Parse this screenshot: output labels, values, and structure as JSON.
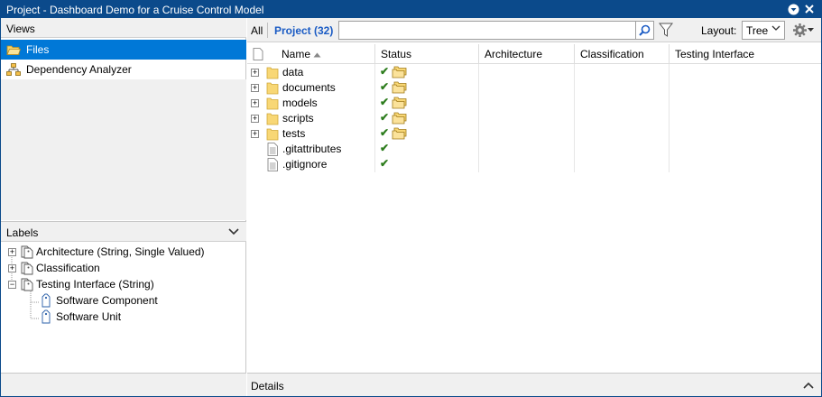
{
  "window": {
    "title": "Project - Dashboard Demo for a Cruise Control Model"
  },
  "views": {
    "header": "Views",
    "items": [
      {
        "label": "Files",
        "icon": "folder-open-icon",
        "selected": true
      },
      {
        "label": "Dependency Analyzer",
        "icon": "hierarchy-icon",
        "selected": false
      }
    ]
  },
  "labels": {
    "header": "Labels",
    "items": [
      {
        "label": "Architecture (String, Single Valued)"
      },
      {
        "label": "Classification"
      },
      {
        "label": "Testing Interface (String)"
      },
      {
        "label": "Software Component"
      },
      {
        "label": "Software Unit"
      }
    ]
  },
  "toolbar": {
    "all_label": "All",
    "project_label": "Project (32)",
    "search_value": "",
    "layout_label": "Layout:",
    "layout_value": "Tree"
  },
  "table": {
    "columns": [
      "Name",
      "Status",
      "Architecture",
      "Classification",
      "Testing Interface"
    ],
    "rows": [
      {
        "name": "data",
        "type": "folder"
      },
      {
        "name": "documents",
        "type": "folder"
      },
      {
        "name": "models",
        "type": "folder"
      },
      {
        "name": "scripts",
        "type": "folder"
      },
      {
        "name": "tests",
        "type": "folder"
      },
      {
        "name": ".gitattributes",
        "type": "file"
      },
      {
        "name": ".gitignore",
        "type": "file"
      }
    ]
  },
  "details": {
    "label": "Details"
  },
  "colors": {
    "title_bar": "#0b4a8b",
    "selection": "#0078d7",
    "project_link": "#1a5bc4",
    "check": "#2e7d1e"
  }
}
